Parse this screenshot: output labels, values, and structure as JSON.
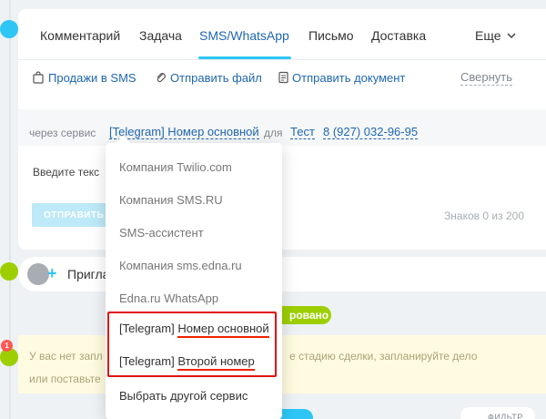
{
  "tabs": [
    {
      "label": "Комментарий"
    },
    {
      "label": "Задача"
    },
    {
      "label": "SMS/WhatsApp"
    },
    {
      "label": "Письмо"
    },
    {
      "label": "Доставка"
    }
  ],
  "more_label": "Еще",
  "actions": {
    "sales_sms": "Продажи в SMS",
    "send_file": "Отправить файл",
    "send_document": "Отправить документ",
    "collapse": "Свернуть"
  },
  "via": {
    "label": "через сервис",
    "service": "[Telegram] Номер основной",
    "for_label": "для",
    "contact": "Тест",
    "phone": "8 (927) 032-96-95"
  },
  "compose": {
    "placeholder": "Введите текс",
    "send_label": "ОТПРАВИТЬ",
    "chars_prefix": "Знаков",
    "chars_count": "0",
    "chars_sep": "из",
    "chars_max": "200"
  },
  "invite_label": "Пригла",
  "status_pill": "ровано",
  "warning": {
    "line1_start": "У вас нет запл",
    "line1_end": "е стадию сделки, запланируйте дело",
    "line2": "или поставьте"
  },
  "notification_count": "1",
  "bottom_pill": "ия",
  "filter_label": "ФИЛЬТР",
  "dropdown": {
    "items": [
      {
        "label": "Компания Twilio.com"
      },
      {
        "label": "Компания SMS.RU"
      },
      {
        "label": "SMS-ассистент"
      },
      {
        "label": "Компания sms.edna.ru"
      },
      {
        "label": "Edna.ru WhatsApp"
      }
    ],
    "telegram_items": [
      {
        "prefix": "[Telegram]",
        "name": "Номер основной"
      },
      {
        "prefix": "[Telegram]",
        "name": "Второй номер"
      }
    ],
    "other": "Выбрать другой сервис"
  },
  "colors": {
    "accent": "#2fc6f6",
    "link": "#2067b0",
    "green": "#9dcf00",
    "highlight": "#e01010"
  }
}
